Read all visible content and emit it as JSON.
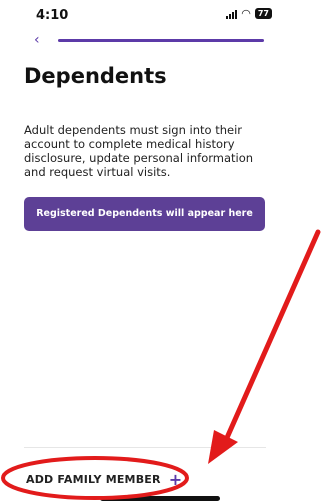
{
  "status_bar": {
    "time": "4:10",
    "battery": "77"
  },
  "nav": {
    "back_icon": "‹"
  },
  "page": {
    "title": "Dependents",
    "description": "Adult dependents must sign into their account to complete medical history disclosure, update personal information and request virtual visits.",
    "info_button_label": "Registered Dependents will appear here"
  },
  "footer": {
    "add_label": "ADD FAMILY MEMBER",
    "add_icon": "+"
  },
  "colors": {
    "accent": "#5c3aa8",
    "button": "#5d4096",
    "annotation": "#e21b1b"
  }
}
